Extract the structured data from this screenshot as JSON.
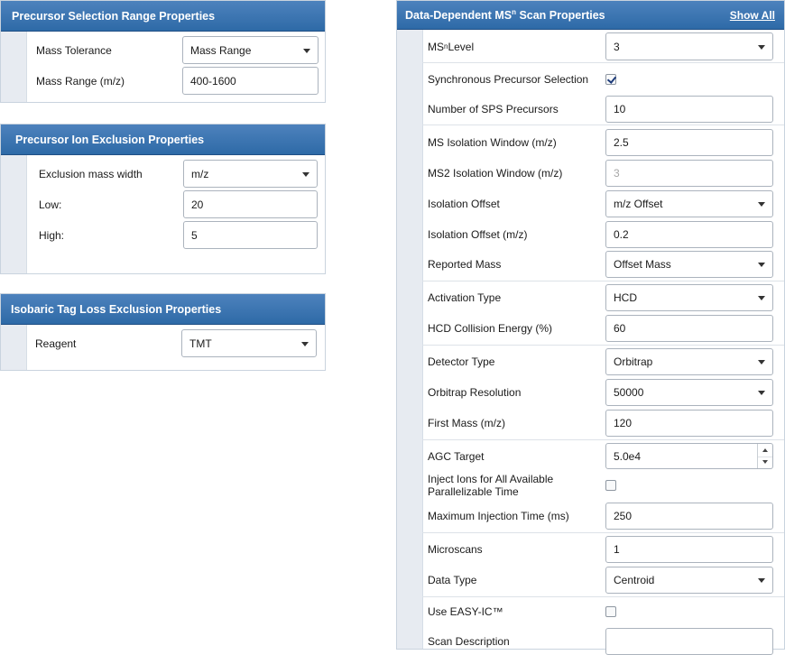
{
  "panels": {
    "precursor_selection": {
      "title": "Precursor Selection Range Properties",
      "mass_tolerance": {
        "label": "Mass Tolerance",
        "value": "Mass Range"
      },
      "mass_range": {
        "label": "Mass Range (m/z)",
        "value": "400-1600"
      }
    },
    "ion_exclusion": {
      "title": "Precursor Ion Exclusion Properties",
      "exclusion_width": {
        "label": "Exclusion mass width",
        "value": "m/z"
      },
      "low": {
        "label": "Low:",
        "value": "20"
      },
      "high": {
        "label": "High:",
        "value": "5"
      }
    },
    "isobaric": {
      "title": "Isobaric Tag Loss Exclusion Properties",
      "reagent": {
        "label": "Reagent",
        "value": "TMT"
      }
    },
    "ddms": {
      "title_prefix": "Data-Dependent MS",
      "title_sup": "n",
      "title_suffix": " Scan Properties",
      "show_all": "Show All",
      "msn_level": {
        "label_prefix": "MS",
        "label_sup": "n",
        "label_suffix": " Level",
        "value": "3"
      },
      "sync_precursor": {
        "label": "Synchronous Precursor Selection",
        "checked": true
      },
      "sps_precursors": {
        "label": "Number of SPS Precursors",
        "value": "10"
      },
      "ms_iso_window": {
        "label": "MS Isolation Window (m/z)",
        "value": "2.5"
      },
      "ms2_iso_window": {
        "label": "MS2 Isolation Window (m/z)",
        "value": "3"
      },
      "iso_offset": {
        "label": "Isolation Offset",
        "value": "m/z Offset"
      },
      "iso_offset_mz": {
        "label": "Isolation Offset (m/z)",
        "value": "0.2"
      },
      "reported_mass": {
        "label": "Reported Mass",
        "value": "Offset Mass"
      },
      "activation_type": {
        "label": "Activation Type",
        "value": "HCD"
      },
      "hcd_energy": {
        "label": "HCD Collision Energy (%)",
        "value": "60"
      },
      "detector_type": {
        "label": "Detector Type",
        "value": "Orbitrap"
      },
      "orbitrap_res": {
        "label": "Orbitrap Resolution",
        "value": "50000"
      },
      "first_mass": {
        "label": "First Mass (m/z)",
        "value": "120"
      },
      "agc_target": {
        "label": "AGC Target",
        "value": "5.0e4"
      },
      "inject_ions": {
        "label": "Inject Ions for All Available Parallelizable Time",
        "checked": false
      },
      "max_inject_time": {
        "label": "Maximum Injection Time (ms)",
        "value": "250"
      },
      "microscans": {
        "label": "Microscans",
        "value": "1"
      },
      "data_type": {
        "label": "Data Type",
        "value": "Centroid"
      },
      "easy_ic": {
        "label": "Use EASY-IC™",
        "checked": false
      },
      "scan_description": {
        "label": "Scan Description",
        "value": ""
      }
    }
  }
}
